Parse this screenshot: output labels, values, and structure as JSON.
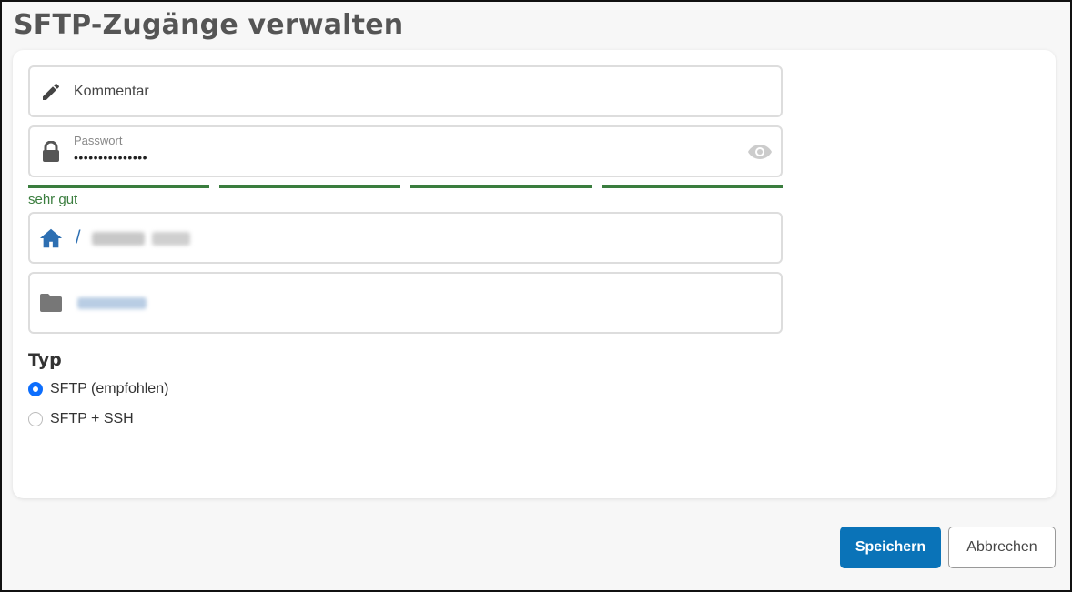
{
  "page": {
    "title": "SFTP-Zugänge verwalten"
  },
  "form": {
    "comment": {
      "placeholder": "Kommentar",
      "icon": "pencil-icon"
    },
    "password": {
      "label": "Passwort",
      "value": "•••••••••••••••",
      "icon": "lock-icon",
      "toggle_icon": "eye-icon"
    },
    "strength": {
      "label": "sehr gut",
      "level": 1.0,
      "color": "#3a7d3e"
    },
    "home_path": {
      "prefix": "/",
      "icon": "home-icon"
    },
    "folder": {
      "icon": "folder-icon"
    },
    "type": {
      "heading": "Typ",
      "options": [
        {
          "label": "SFTP (empfohlen)",
          "checked": true
        },
        {
          "label": "SFTP + SSH",
          "checked": false
        }
      ]
    }
  },
  "actions": {
    "save_label": "Speichern",
    "cancel_label": "Abbrechen"
  },
  "colors": {
    "primary": "#0a73b8",
    "accent_icon": "#2d6fb2",
    "success": "#3a7d3e"
  }
}
